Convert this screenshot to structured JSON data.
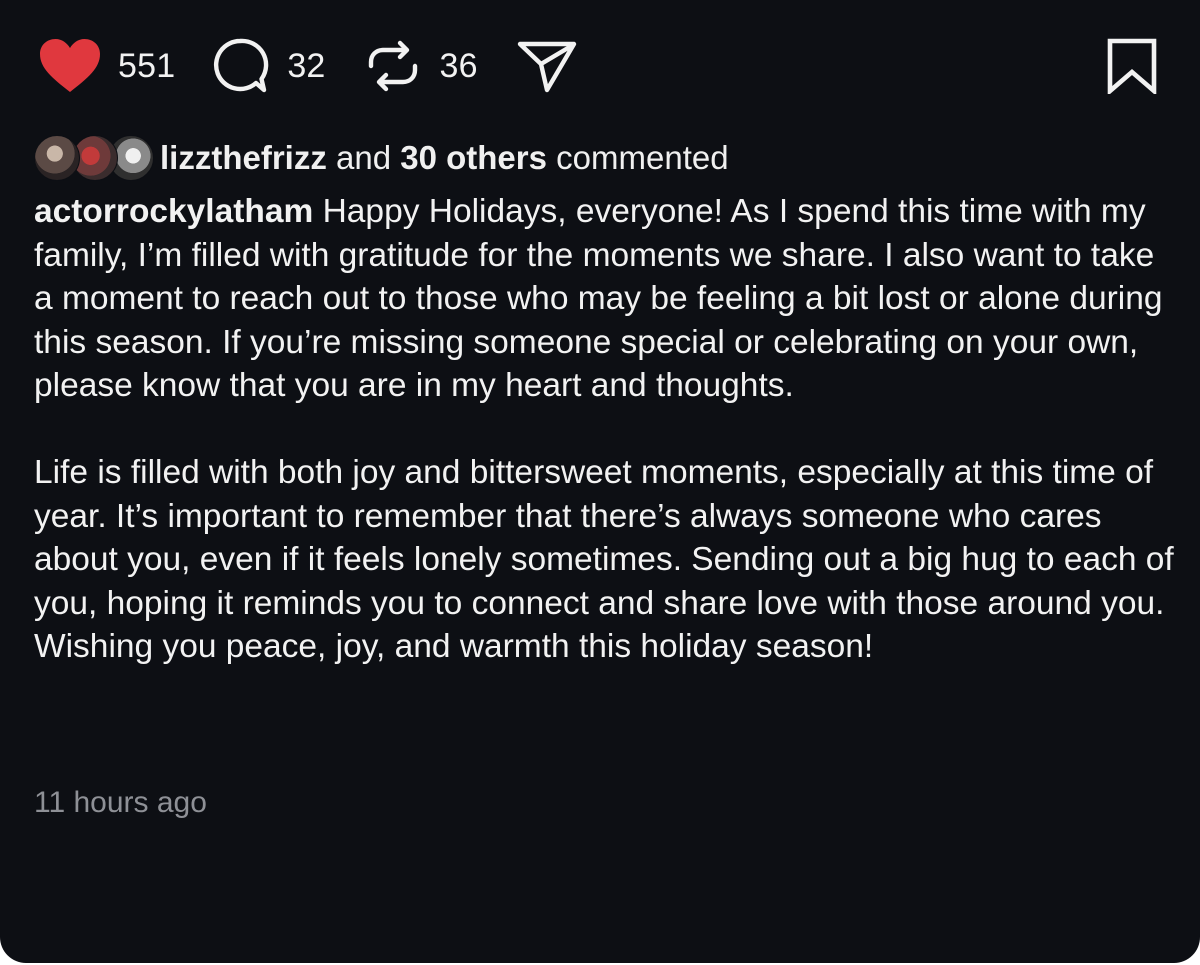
{
  "actions": {
    "likes": "551",
    "comments": "32",
    "reposts": "36",
    "icons": [
      "heart-icon",
      "comment-icon",
      "repost-icon",
      "share-icon",
      "bookmark-icon"
    ],
    "like_color": "#e0383e"
  },
  "commenters": {
    "username": "lizzthefrizz",
    "connector": " and ",
    "others": "30 others",
    "suffix": " commented"
  },
  "comment": {
    "author": "actorrockylatham",
    "paragraph1": "Happy Holidays, everyone! As I spend this time with my family, I’m filled with gratitude for the moments we share. I also want to take a moment to reach out to those who may be feeling a bit lost or alone during this season. If you’re missing someone special or celebrating on your own, please know that you are in my heart and thoughts.",
    "paragraph2": "Life is filled with both joy and bittersweet moments, especially at this time of year. It’s important to remember that there’s always someone who cares about you, even if it feels lonely sometimes. Sending out a big hug to each of you, hoping it reminds you to connect and share love with those around you. Wishing you peace, joy, and warmth this holiday season!",
    "timestamp": "11 hours ago"
  },
  "colors": {
    "background": "#0d0f14",
    "text": "#f2f2f2",
    "muted": "#8e9096"
  }
}
